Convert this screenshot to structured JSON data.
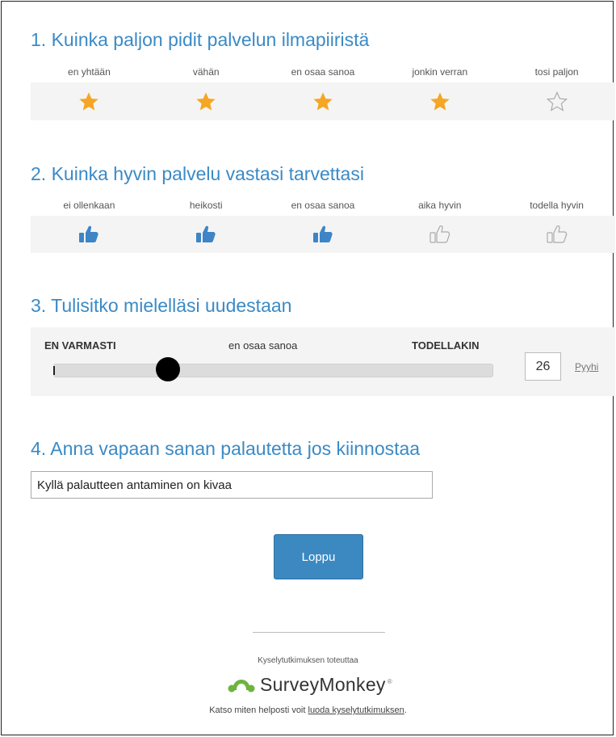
{
  "q1": {
    "title": "1. Kuinka paljon pidit palvelun ilmapiiristä",
    "options": [
      "en yhtään",
      "vähän",
      "en osaa sanoa",
      "jonkin verran",
      "tosi paljon"
    ],
    "rating": 4,
    "filled_color": "#f5a623",
    "icon": "star-icon"
  },
  "q2": {
    "title": "2. Kuinka hyvin palvelu vastasi tarvettasi",
    "options": [
      "ei ollenkaan",
      "heikosti",
      "en osaa sanoa",
      "aika hyvin",
      "todella hyvin"
    ],
    "rating": 3,
    "filled_color": "#3d85c6",
    "icon": "thumbs-up-icon"
  },
  "q3": {
    "title": "3. Tulisitko mielelläsi uudestaan",
    "label_left": "EN VARMASTI",
    "label_mid": "en osaa sanoa",
    "label_right": "TODELLAKIN",
    "value": "26",
    "clear_label": "Pyyhi"
  },
  "q4": {
    "title": "4. Anna vapaan sanan palautetta jos kiinnostaa",
    "value": "Kyllä palautteen antaminen on kivaa"
  },
  "submit_label": "Loppu",
  "footer": {
    "powered_by": "Kyselytutkimuksen toteuttaa",
    "brand": "SurveyMonkey",
    "brand_reg": "®",
    "cta_prefix": "Katso miten helposti voit ",
    "cta_link": "luoda kyselytutkimuksen",
    "cta_suffix": "."
  },
  "colors": {
    "accent": "#3a8ac6",
    "button": "#3c89c2",
    "brand_green": "#6fb33f"
  }
}
